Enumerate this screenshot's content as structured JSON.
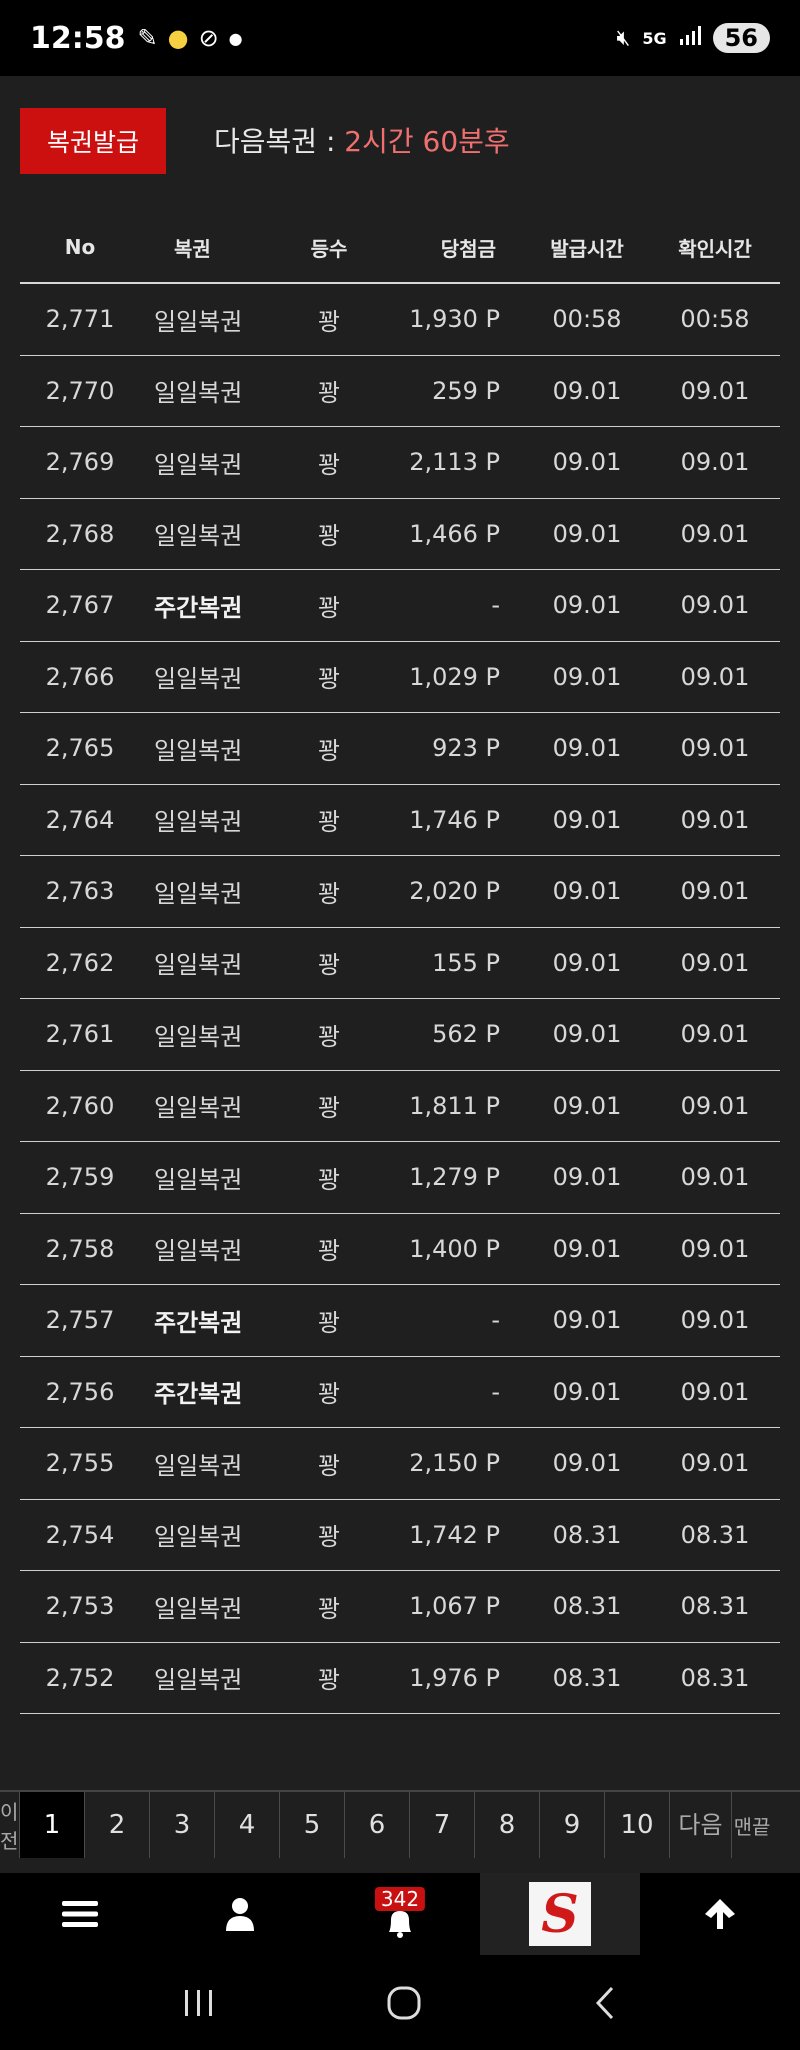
{
  "status_bar": {
    "time": "12:58",
    "network": "5G",
    "battery": "56",
    "icons": [
      "notification-pen-icon",
      "notification-pill-icon",
      "notification-link-icon",
      "dot-icon",
      "mute-icon",
      "signal-icon"
    ]
  },
  "header": {
    "issue_button": "복권발급",
    "next_label": "다음복권 : ",
    "next_value": "2시간 60분후"
  },
  "table": {
    "columns": [
      "No",
      "복권",
      "등수",
      "당첨금",
      "발급시간",
      "확인시간"
    ],
    "rows": [
      {
        "no": "2,771",
        "type": "일일복권",
        "grade": "꽝",
        "prize": "1,930 P",
        "issued": "00:58",
        "checked": "00:58",
        "weekly": false
      },
      {
        "no": "2,770",
        "type": "일일복권",
        "grade": "꽝",
        "prize": "259 P",
        "issued": "09.01",
        "checked": "09.01",
        "weekly": false
      },
      {
        "no": "2,769",
        "type": "일일복권",
        "grade": "꽝",
        "prize": "2,113 P",
        "issued": "09.01",
        "checked": "09.01",
        "weekly": false
      },
      {
        "no": "2,768",
        "type": "일일복권",
        "grade": "꽝",
        "prize": "1,466 P",
        "issued": "09.01",
        "checked": "09.01",
        "weekly": false
      },
      {
        "no": "2,767",
        "type": "주간복권",
        "grade": "꽝",
        "prize": "-",
        "issued": "09.01",
        "checked": "09.01",
        "weekly": true
      },
      {
        "no": "2,766",
        "type": "일일복권",
        "grade": "꽝",
        "prize": "1,029 P",
        "issued": "09.01",
        "checked": "09.01",
        "weekly": false
      },
      {
        "no": "2,765",
        "type": "일일복권",
        "grade": "꽝",
        "prize": "923 P",
        "issued": "09.01",
        "checked": "09.01",
        "weekly": false
      },
      {
        "no": "2,764",
        "type": "일일복권",
        "grade": "꽝",
        "prize": "1,746 P",
        "issued": "09.01",
        "checked": "09.01",
        "weekly": false
      },
      {
        "no": "2,763",
        "type": "일일복권",
        "grade": "꽝",
        "prize": "2,020 P",
        "issued": "09.01",
        "checked": "09.01",
        "weekly": false
      },
      {
        "no": "2,762",
        "type": "일일복권",
        "grade": "꽝",
        "prize": "155 P",
        "issued": "09.01",
        "checked": "09.01",
        "weekly": false
      },
      {
        "no": "2,761",
        "type": "일일복권",
        "grade": "꽝",
        "prize": "562 P",
        "issued": "09.01",
        "checked": "09.01",
        "weekly": false
      },
      {
        "no": "2,760",
        "type": "일일복권",
        "grade": "꽝",
        "prize": "1,811 P",
        "issued": "09.01",
        "checked": "09.01",
        "weekly": false
      },
      {
        "no": "2,759",
        "type": "일일복권",
        "grade": "꽝",
        "prize": "1,279 P",
        "issued": "09.01",
        "checked": "09.01",
        "weekly": false
      },
      {
        "no": "2,758",
        "type": "일일복권",
        "grade": "꽝",
        "prize": "1,400 P",
        "issued": "09.01",
        "checked": "09.01",
        "weekly": false
      },
      {
        "no": "2,757",
        "type": "주간복권",
        "grade": "꽝",
        "prize": "-",
        "issued": "09.01",
        "checked": "09.01",
        "weekly": true
      },
      {
        "no": "2,756",
        "type": "주간복권",
        "grade": "꽝",
        "prize": "-",
        "issued": "09.01",
        "checked": "09.01",
        "weekly": true
      },
      {
        "no": "2,755",
        "type": "일일복권",
        "grade": "꽝",
        "prize": "2,150 P",
        "issued": "09.01",
        "checked": "09.01",
        "weekly": false
      },
      {
        "no": "2,754",
        "type": "일일복권",
        "grade": "꽝",
        "prize": "1,742 P",
        "issued": "08.31",
        "checked": "08.31",
        "weekly": false
      },
      {
        "no": "2,753",
        "type": "일일복권",
        "grade": "꽝",
        "prize": "1,067 P",
        "issued": "08.31",
        "checked": "08.31",
        "weekly": false
      },
      {
        "no": "2,752",
        "type": "일일복권",
        "grade": "꽝",
        "prize": "1,976 P",
        "issued": "08.31",
        "checked": "08.31",
        "weekly": false
      }
    ]
  },
  "pagination": {
    "prev_label": "이전",
    "pages": [
      "1",
      "2",
      "3",
      "4",
      "5",
      "6",
      "7",
      "8",
      "9",
      "10"
    ],
    "active": "1",
    "next_label": "다음",
    "last_label": "맨끝"
  },
  "bottom_nav": {
    "bell_count": "342",
    "logo_letter": "S"
  },
  "colors": {
    "accent_red": "#cc1010",
    "highlight_text": "#f07070",
    "background": "#1f1f1f"
  }
}
